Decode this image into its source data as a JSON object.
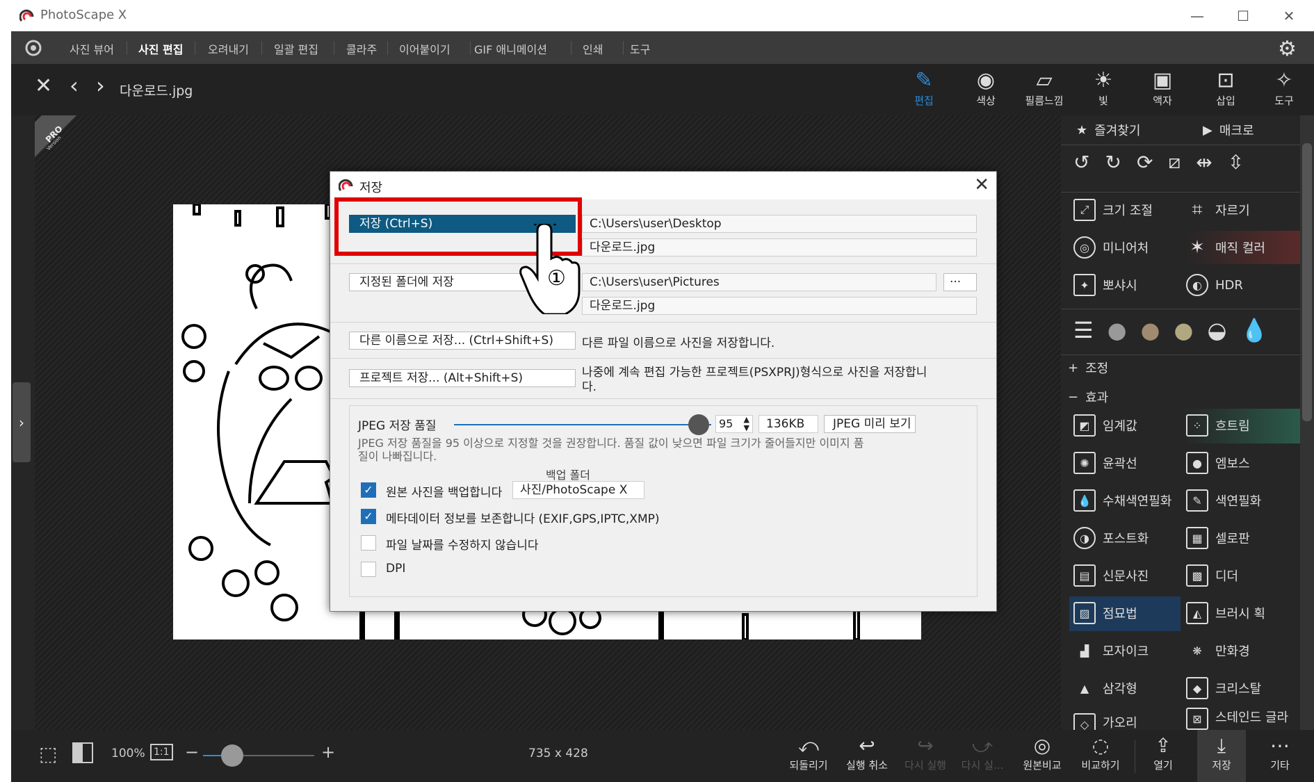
{
  "app": {
    "title": "PhotoScape X",
    "accent": "#1e7ec8"
  },
  "menu": {
    "items": [
      "사진 뷰어",
      "사진 편집",
      "오려내기",
      "일괄 편집",
      "콜라주",
      "이어붙이기",
      "GIF 애니메이션",
      "인쇄",
      "도구"
    ],
    "active": "사진 편집"
  },
  "viewer": {
    "filename": "다운로드.jpg",
    "pro_badge": "PRO Version",
    "image_size": "735 x 428",
    "zoom": "100%",
    "ratio_btn": "1:1"
  },
  "top_tools": [
    {
      "label": "편집",
      "icon": "edit-icon",
      "active": true
    },
    {
      "label": "색상",
      "icon": "color-icon"
    },
    {
      "label": "필름느낌",
      "icon": "film-icon"
    },
    {
      "label": "빛",
      "icon": "light-icon"
    },
    {
      "label": "액자",
      "icon": "frame-icon"
    },
    {
      "label": "삽입",
      "icon": "insert-icon"
    },
    {
      "label": "도구",
      "icon": "tool-icon"
    }
  ],
  "panel": {
    "fav": "즐겨찾기",
    "macro": "매크로",
    "tools": [
      [
        "크기 조절",
        "자르기"
      ],
      [
        "미니어처",
        "매직 컬러"
      ],
      [
        "뽀샤시",
        "HDR"
      ]
    ],
    "adjust": "조정",
    "effects": "효과",
    "effect_items": [
      [
        "임계값",
        "흐트림"
      ],
      [
        "윤곽선",
        "엠보스"
      ],
      [
        "수채색연필화",
        "색연필화"
      ],
      [
        "포스트화",
        "셀로판"
      ],
      [
        "신문사진",
        "디더"
      ],
      [
        "점묘법",
        "브러시 획"
      ],
      [
        "모자이크",
        "만화경"
      ],
      [
        "삼각형",
        "크리스탈"
      ],
      [
        "가오리",
        "스테인드 글라"
      ]
    ]
  },
  "dialog": {
    "title": "저장",
    "save_btn": "저장   (Ctrl+S)",
    "save_path": "C:\\Users\\user\\Desktop",
    "save_file": "다운로드.jpg",
    "folder_btn": "지정된 폴더에 저장",
    "folder_path": "C:\\Users\\user\\Pictures",
    "folder_file": "다운로드.jpg",
    "browse": "···",
    "saveas_btn": "다른 이름으로 저장...   (Ctrl+Shift+S)",
    "saveas_desc": "다른 파일 이름으로 사진을 저장합니다.",
    "project_btn": "프로젝트 저장...   (Alt+Shift+S)",
    "project_desc_1": "나중에 계속 편집 가능한 프로젝트(PSXPRJ)형식으로 사진을 저장합니",
    "project_desc_2": "다.",
    "quality_label": "JPEG 저장 품질",
    "quality_value": "95",
    "quality_fraction": 0.95,
    "file_size": "136KB",
    "preview_btn": "JPEG 미리 보기",
    "quality_note_1": "JPEG 저장 품질을 95 이상으로 지정할 것을 권장합니다. 품질 값이 낮으면 파일 크기가 줄어들지만 이미지 품",
    "quality_note_2": "질이 나빠집니다.",
    "backup_folder_label": "백업 폴더",
    "backup_folder": "사진/PhotoScape X",
    "opt_backup": "원본 사진을 백업합니다",
    "opt_meta": "메타데이터 정보를 보존합니다 (EXIF,GPS,IPTC,XMP)",
    "opt_date": "파일 날짜를 수정하지 않습니다",
    "opt_dpi": "DPI",
    "close": "✕",
    "step_marker": "①"
  },
  "bottom": [
    {
      "label": "되돌리기",
      "icon": "revert-icon"
    },
    {
      "label": "실행 취소",
      "icon": "undo-icon"
    },
    {
      "label": "다시 실행",
      "icon": "redo-icon",
      "disabled": true
    },
    {
      "label": "다시 실...",
      "icon": "redo-all-icon",
      "disabled": true
    },
    {
      "label": "원본비교",
      "icon": "compare-icon"
    },
    {
      "label": "비교하기",
      "icon": "compare2-icon"
    },
    {
      "label": "열기",
      "icon": "open-icon"
    },
    {
      "label": "저장",
      "icon": "save-icon",
      "active": true
    },
    {
      "label": "기타",
      "icon": "more-icon"
    }
  ]
}
